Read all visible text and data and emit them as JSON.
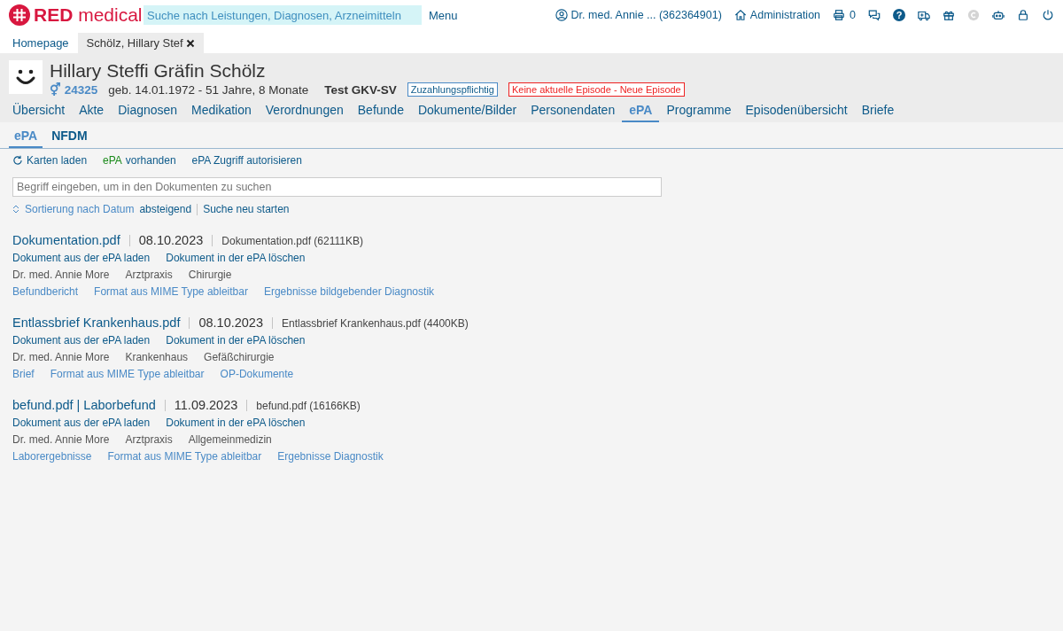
{
  "topbar": {
    "logo": "**RED** medical",
    "search_placeholder": "Suche nach Leistungen, Diagnosen, Arzneimitteln",
    "menu": "Menu",
    "user": "Dr. med. Annie ... (362364901)",
    "admin": "Administration",
    "tools": [
      {
        "kind": "printer",
        "count": "0",
        "disabled": false
      },
      {
        "kind": "chat",
        "disabled": false
      },
      {
        "kind": "help",
        "glyph": "?",
        "disabled": false
      },
      {
        "kind": "ambulance",
        "disabled": false
      },
      {
        "kind": "gift",
        "disabled": false
      },
      {
        "kind": "copyright",
        "disabled": true
      },
      {
        "kind": "robot",
        "disabled": false
      },
      {
        "kind": "lock",
        "disabled": false
      },
      {
        "kind": "power",
        "disabled": false
      }
    ]
  },
  "open_tabs": [
    {
      "label": "Homepage",
      "selected": false,
      "closable": false
    },
    {
      "label": "Schölz, Hillary Stef",
      "selected": true,
      "closable": true
    }
  ],
  "patient": {
    "name": "Hillary Steffi Gräfin Schölz",
    "gender_symbol": "⚥",
    "id": "24325",
    "birth": "geb. 14.01.1972 - 51 Jahre, 8 Monate",
    "insurance": "Test GKV-SV",
    "badges": [
      {
        "text": "Zuzahlungspflichtig",
        "kind": "info"
      },
      {
        "text": "Keine aktuelle Episode - Neue Episode",
        "kind": "alert"
      }
    ]
  },
  "nav_tabs": [
    {
      "label": "Übersicht",
      "selected": false
    },
    {
      "label": "Akte",
      "selected": false
    },
    {
      "label": "Diagnosen",
      "selected": false
    },
    {
      "label": "Medikation",
      "selected": false
    },
    {
      "label": "Verordnungen",
      "selected": false
    },
    {
      "label": "Befunde",
      "selected": false
    },
    {
      "label": "Dokumente/Bilder",
      "selected": false
    },
    {
      "label": "Personendaten",
      "selected": false
    },
    {
      "label": "ePA",
      "selected": true
    },
    {
      "label": "Programme",
      "selected": false
    },
    {
      "label": "Episodenübersicht",
      "selected": false
    },
    {
      "label": "Briefe",
      "selected": false
    }
  ],
  "sub_tabs": [
    {
      "label": "ePA",
      "selected": true
    },
    {
      "label": "NFDM",
      "selected": false
    }
  ],
  "actions": {
    "load_cards": "Karten laden",
    "epa_label": "ePA",
    "epa_status": "vorhanden",
    "epa_available": true,
    "authorize": "ePA Zugriff autorisieren"
  },
  "search": {
    "placeholder": "Begriff eingeben, um in den Dokumenten zu suchen"
  },
  "sort": {
    "label": "Sortierung nach Datum",
    "order": "absteigend",
    "restart": "Suche neu starten"
  },
  "documents": [
    {
      "title": "Dokumentation.pdf",
      "date": "08.10.2023",
      "file": "Dokumentation.pdf (62111KB)",
      "actions": [
        "Dokument aus der ePA laden",
        "Dokument in der ePA löschen"
      ],
      "meta": [
        "Dr. med. Annie More",
        "Arztpraxis",
        "Chirurgie"
      ],
      "tags": [
        "Befundbericht",
        "Format aus MIME Type ableitbar",
        "Ergebnisse bildgebender Diagnostik"
      ]
    },
    {
      "title": "Entlassbrief Krankenhaus.pdf",
      "date": "08.10.2023",
      "file": "Entlassbrief Krankenhaus.pdf (4400KB)",
      "actions": [
        "Dokument aus der ePA laden",
        "Dokument in der ePA löschen"
      ],
      "meta": [
        "Dr. med. Annie More",
        "Krankenhaus",
        "Gefäßchirurgie"
      ],
      "tags": [
        "Brief",
        "Format aus MIME Type ableitbar",
        "OP-Dokumente"
      ]
    },
    {
      "title": "befund.pdf | Laborbefund",
      "date": "11.09.2023",
      "file": "befund.pdf (16166KB)",
      "actions": [
        "Dokument aus der ePA laden",
        "Dokument in der ePA löschen"
      ],
      "meta": [
        "Dr. med. Annie More",
        "Arztpraxis",
        "Allgemeinmedizin"
      ],
      "tags": [
        "Laborergebnisse",
        "Format aus MIME Type ableitbar",
        "Ergebnisse Diagnostik"
      ]
    }
  ]
}
